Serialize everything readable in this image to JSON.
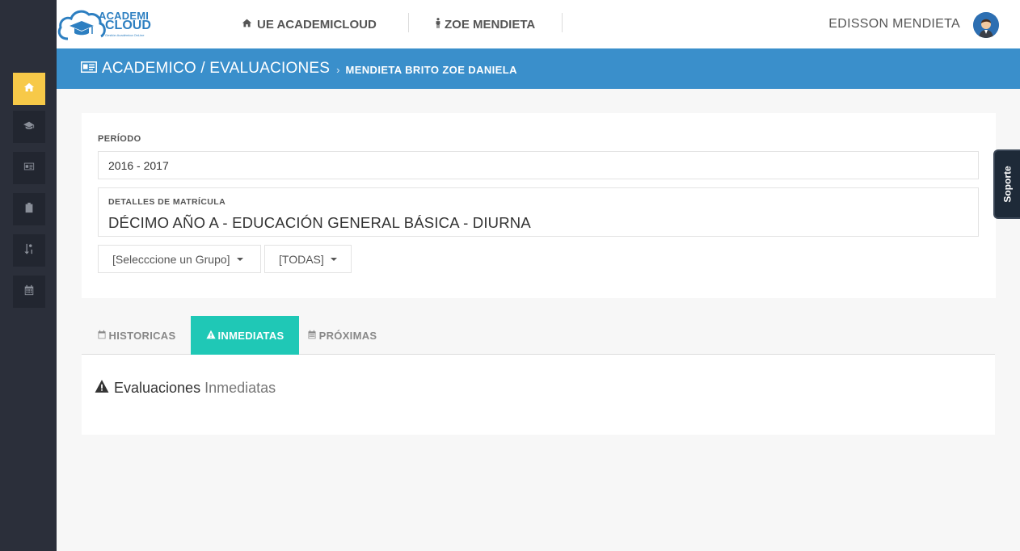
{
  "brand": {
    "name_line1": "ACADEMI",
    "name_line2": "CLOUD",
    "tagline": "Gestión Académica OnLine",
    "color": "#2d7fc1"
  },
  "header": {
    "nav": [
      {
        "label": "UE ACADEMICLOUD",
        "icon": "home-icon"
      },
      {
        "label": "ZOE MENDIETA",
        "icon": "male-icon"
      }
    ],
    "user_name": "EDISSON MENDIETA"
  },
  "sidebar": {
    "items": [
      {
        "icon": "home-icon",
        "active": true
      },
      {
        "icon": "graduation-cap-icon",
        "active": false
      },
      {
        "icon": "id-card-icon",
        "active": false
      },
      {
        "icon": "clipboard-icon",
        "active": false
      },
      {
        "icon": "sort-numeric-icon",
        "active": false
      },
      {
        "icon": "calendar-icon",
        "active": false
      }
    ]
  },
  "breadcrumb": {
    "section": "ACADEMICO / EVALUACIONES",
    "separator": "›",
    "student": "MENDIETA BRITO ZOE DANIELA"
  },
  "form": {
    "period_label": "PERÍODO",
    "period_value": "2016 - 2017",
    "enrollment_label": "DETALLES DE MATRÍCULA",
    "enrollment_value": "DÉCIMO AÑO A - EDUCACIÓN GENERAL BÁSICA - DIURNA",
    "group_dropdown": "[Selecccione un Grupo]",
    "filter_dropdown": "[TODAS]"
  },
  "tabs": [
    {
      "label": "HISTORICAS",
      "icon": "calendar-o-icon",
      "active": false
    },
    {
      "label": "INMEDIATAS",
      "icon": "warning-icon",
      "active": true
    },
    {
      "label": "PRÓXIMAS",
      "icon": "calendar-icon",
      "active": false
    }
  ],
  "content": {
    "title_strong": "Evaluaciones",
    "title_light": "Inmediatas"
  },
  "support_label": "Soporte",
  "colors": {
    "sidebar_bg": "#2b2f3a",
    "active_sidebar": "#f7c948",
    "breadcrumb_bg": "#3a8fcb",
    "active_tab": "#1fc8b6"
  }
}
